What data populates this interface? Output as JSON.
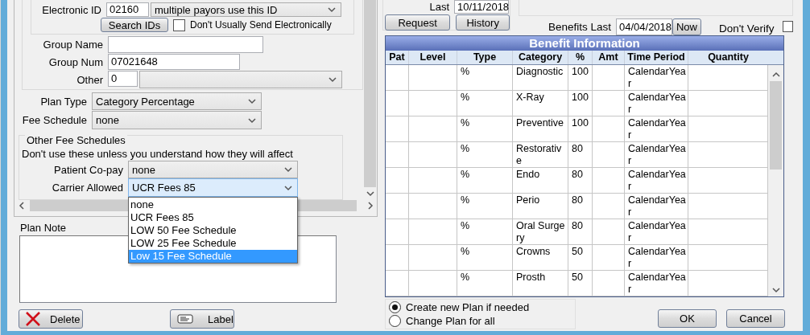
{
  "electronic_id": {
    "label": "Electronic ID",
    "value": "02160",
    "payor": "multiple payors use this ID"
  },
  "search_ids_button": "Search IDs",
  "dont_usually_send": {
    "label": "Don't Usually Send Electronically",
    "checked": false
  },
  "group_name": {
    "label": "Group Name"
  },
  "group_num": {
    "label": "Group Num",
    "value": "07021648"
  },
  "other": {
    "label": "Other",
    "value": "0"
  },
  "plan_type": {
    "label": "Plan Type",
    "value": "Category Percentage"
  },
  "fee_schedule": {
    "label": "Fee Schedule",
    "value": "none"
  },
  "other_fee_schedules": {
    "title": "Other Fee Schedules",
    "note": "Don't use these unless you understand how they will affect",
    "patient_copay": {
      "label": "Patient Co-pay",
      "value": "none"
    },
    "carrier_allowed": {
      "label": "Carrier Allowed",
      "value": "UCR Fees 85",
      "open": true,
      "options": [
        {
          "label": "none",
          "highlighted": false
        },
        {
          "label": "UCR Fees 85",
          "highlighted": false
        },
        {
          "label": "LOW 50 Fee Schedule",
          "highlighted": false
        },
        {
          "label": "LOW 25 Fee Schedule",
          "highlighted": false
        },
        {
          "label": "Low 15 Fee Schedule",
          "highlighted": true
        }
      ]
    }
  },
  "plan_note": {
    "label": "Plan Note"
  },
  "left_buttons": [
    {
      "label": "Delete",
      "kind": "delete"
    },
    {
      "label": "Label",
      "kind": "label"
    }
  ],
  "last": {
    "label": "Last",
    "value": "10/11/2018"
  },
  "verify_buttons": [
    "Request",
    "History"
  ],
  "benefits_last": {
    "label": "Benefits Last",
    "value": "04/04/2018",
    "button": "Now"
  },
  "dont_verify": {
    "label": "Don't Verify",
    "checked": false
  },
  "benefit_table": {
    "title": "Benefit Information",
    "columns": [
      "Pat",
      "Level",
      "Type",
      "Category",
      "%",
      "Amt",
      "Time Period",
      "Quantity"
    ],
    "rows": [
      {
        "type": "%",
        "category": "Diagnostic",
        "percent": "100",
        "time_period": "CalendarYear"
      },
      {
        "type": "%",
        "category": "X-Ray",
        "percent": "100",
        "time_period": "CalendarYear"
      },
      {
        "type": "%",
        "category": "Preventive",
        "percent": "100",
        "time_period": "CalendarYear"
      },
      {
        "type": "%",
        "category": "Restorative",
        "percent": "80",
        "time_period": "CalendarYear"
      },
      {
        "type": "%",
        "category": "Endo",
        "percent": "80",
        "time_period": "CalendarYear"
      },
      {
        "type": "%",
        "category": "Perio",
        "percent": "80",
        "time_period": "CalendarYear"
      },
      {
        "type": "%",
        "category": "Oral Surgery",
        "percent": "80",
        "time_period": "CalendarYear"
      },
      {
        "type": "%",
        "category": "Crowns",
        "percent": "50",
        "time_period": "CalendarYear"
      },
      {
        "type": "%",
        "category": "Prosth",
        "percent": "50",
        "time_period": "CalendarYear"
      }
    ]
  },
  "plan_options": [
    {
      "label": "Create new Plan if needed",
      "selected": true
    },
    {
      "label": "Change Plan for all",
      "selected": false
    }
  ],
  "dialog_buttons": [
    "OK",
    "Cancel"
  ]
}
